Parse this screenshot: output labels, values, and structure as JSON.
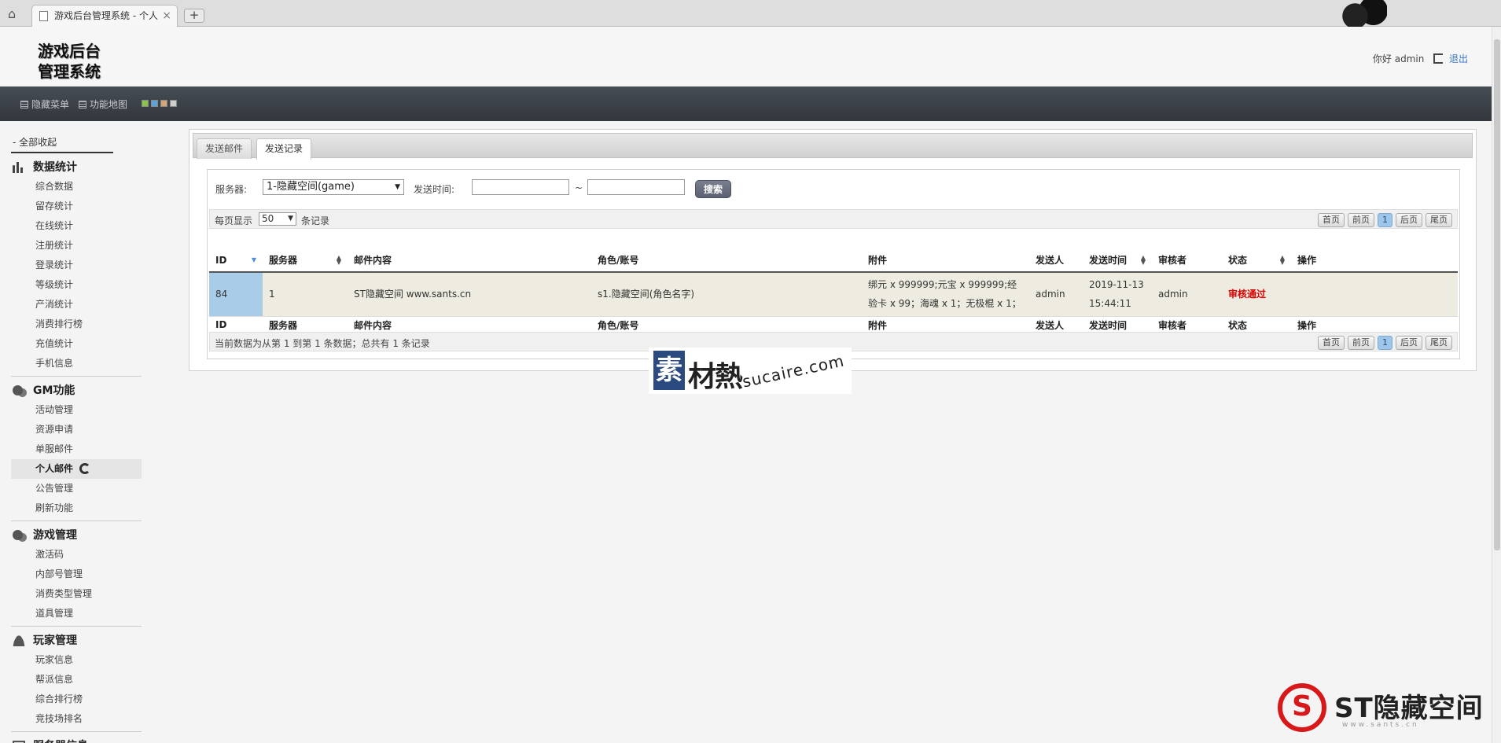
{
  "browser": {
    "tab_title": "游戏后台管理系统 - 个人",
    "close_glyph": "×",
    "new_tab_glyph": "+",
    "home_glyph": "⌂"
  },
  "header": {
    "logo_line1": "游戏后台",
    "logo_line2": "管理系统",
    "greeting": "你好 admin",
    "logout_label": "退出"
  },
  "toolbar": {
    "hide_menu_label": "隐藏菜单",
    "function_map_label": "功能地图",
    "theme_swatches": [
      "#8bc34a",
      "#5ba3d6",
      "#d2a679",
      "#cfcfcf"
    ]
  },
  "sidebar": {
    "collapse_all": "- 全部收起",
    "groups": [
      {
        "title": "数据统计",
        "icon": "bar-chart-icon",
        "items": [
          "综合数据",
          "留存统计",
          "在线统计",
          "注册统计",
          "登录统计",
          "等级统计",
          "产消统计",
          "消费排行榜",
          "充值统计",
          "手机信息"
        ]
      },
      {
        "title": "GM功能",
        "icon": "chat-bubbles-icon",
        "items": [
          "活动管理",
          "资源申请",
          "单服邮件",
          "个人邮件",
          "公告管理",
          "刷新功能"
        ],
        "active_item": "个人邮件"
      },
      {
        "title": "游戏管理",
        "icon": "chat-bubbles-icon",
        "items": [
          "激活码",
          "内部号管理",
          "消费类型管理",
          "道具管理"
        ]
      },
      {
        "title": "玩家管理",
        "icon": "person-icon",
        "items": [
          "玩家信息",
          "帮派信息",
          "综合排行榜",
          "竞技场排名"
        ]
      },
      {
        "title": "服务器信息",
        "icon": "servers-icon",
        "items": []
      }
    ]
  },
  "main": {
    "tabs": [
      "发送邮件",
      "发送记录"
    ],
    "active_tab": "发送记录",
    "filter": {
      "server_label": "服务器:",
      "server_value": "1-隐藏空间(game)",
      "time_label": "发送时间:",
      "range_sep": "~",
      "time_from": "",
      "time_to": "",
      "search_label": "搜索"
    },
    "page_size": {
      "prefix": "每页显示",
      "value": "50",
      "suffix": "条记录"
    },
    "pager": {
      "first": "首页",
      "prev": "前页",
      "current": "1",
      "next": "后页",
      "last": "尾页"
    },
    "columns": [
      "ID",
      "服务器",
      "邮件内容",
      "角色/账号",
      "附件",
      "发送人",
      "发送时间",
      "审核者",
      "状态",
      "操作"
    ],
    "rows": [
      {
        "id": "84",
        "server": "1",
        "content": "ST隐藏空间 www.sants.cn",
        "role": "s1.隐藏空间(角色名字)",
        "attachment_line1": "绑元 x 999999;元宝 x 999999;经",
        "attachment_line2": "验卡 x 99；海魂 x 1；无极棍 x 1；",
        "sender": "admin",
        "send_date": "2019-11-13",
        "send_time": "15:44:11",
        "reviewer": "admin",
        "status": "审核通过",
        "action": ""
      }
    ],
    "summary": "当前数据为从第 1 到第 1 条数据；总共有 1 条记录"
  },
  "watermarks": {
    "center_box": "素",
    "center_cn": "材熱",
    "center_en": "sucaire.com",
    "corner_logo": "S",
    "corner_text": "ST隐藏空间",
    "corner_sub": "www.sants.cn"
  },
  "colors": {
    "toolbar_bg": "#3b4047",
    "row_bg": "#eeece0",
    "id_cell_bg": "#a9cde8",
    "status_color": "#dd0000",
    "accent_link": "#3a77c4"
  }
}
